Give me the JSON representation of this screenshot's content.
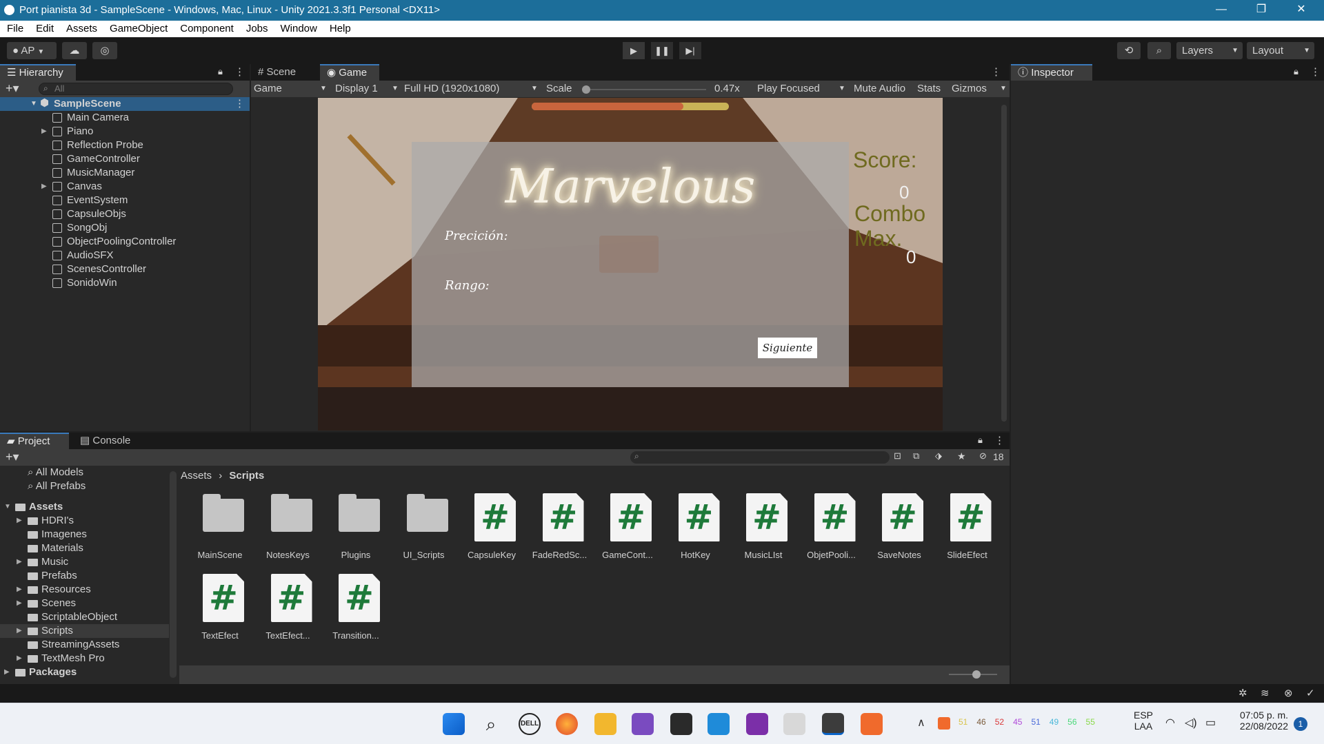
{
  "window": {
    "title": "Port pianista 3d - SampleScene - Windows, Mac, Linux - Unity 2021.3.3f1 Personal <DX11>",
    "controls": [
      "—",
      "❐",
      "✕"
    ]
  },
  "menu": [
    "File",
    "Edit",
    "Assets",
    "GameObject",
    "Component",
    "Jobs",
    "Window",
    "Help"
  ],
  "toolbar": {
    "account": "AP",
    "layers": "Layers",
    "layout": "Layout"
  },
  "hierarchy": {
    "tab": "Hierarchy",
    "search_placeholder": "All",
    "scene": "SampleScene",
    "items": [
      {
        "label": "Main Camera",
        "expandable": false
      },
      {
        "label": "Piano",
        "expandable": true
      },
      {
        "label": "Reflection Probe",
        "expandable": false
      },
      {
        "label": "GameController",
        "expandable": false
      },
      {
        "label": "MusicManager",
        "expandable": false
      },
      {
        "label": "Canvas",
        "expandable": true
      },
      {
        "label": "EventSystem",
        "expandable": false
      },
      {
        "label": "CapsuleObjs",
        "expandable": false
      },
      {
        "label": "SongObj",
        "expandable": false
      },
      {
        "label": "ObjectPoolingController",
        "expandable": false
      },
      {
        "label": "AudioSFX",
        "expandable": false
      },
      {
        "label": "ScenesController",
        "expandable": false
      },
      {
        "label": "SonidoWin",
        "expandable": false
      }
    ]
  },
  "views": {
    "scene_tab": "Scene",
    "game_tab": "Game",
    "game_dropdown": "Game",
    "display": "Display 1",
    "resolution": "Full HD (1920x1080)",
    "scale_label": "Scale",
    "scale_value": "0.47x",
    "play_focused": "Play Focused",
    "mute_audio": "Mute Audio",
    "stats": "Stats",
    "gizmos": "Gizmos"
  },
  "game": {
    "rating": "Marvelous",
    "precision_label": "Preciciόn:",
    "rank_label": "Rango:",
    "next_button": "Siguiente",
    "score_label": "Score:",
    "score_value": "0",
    "combo_label": "Combo",
    "max_label": "Max.",
    "combo_value": "0",
    "progress": 0.77
  },
  "inspector": {
    "tab": "Inspector"
  },
  "project": {
    "tab_project": "Project",
    "tab_console": "Console",
    "hidden_count": "18",
    "favorites": [
      "All Models",
      "All Prefabs"
    ],
    "assets_root": "Assets",
    "folders": [
      {
        "label": "HDRI's",
        "expandable": true
      },
      {
        "label": "Imagenes",
        "expandable": false
      },
      {
        "label": "Materials",
        "expandable": false
      },
      {
        "label": "Music",
        "expandable": true
      },
      {
        "label": "Prefabs",
        "expandable": false
      },
      {
        "label": "Resources",
        "expandable": true
      },
      {
        "label": "Scenes",
        "expandable": true
      },
      {
        "label": "ScriptableObject",
        "expandable": false
      },
      {
        "label": "Scripts",
        "expandable": true,
        "selected": true
      },
      {
        "label": "StreamingAssets",
        "expandable": false
      },
      {
        "label": "TextMesh Pro",
        "expandable": true
      }
    ],
    "packages": "Packages",
    "breadcrumb": [
      "Assets",
      "Scripts"
    ],
    "assets": [
      {
        "name": "MainScene",
        "kind": "folder"
      },
      {
        "name": "NotesKeys",
        "kind": "folder"
      },
      {
        "name": "Plugins",
        "kind": "folder"
      },
      {
        "name": "UI_Scripts",
        "kind": "folder"
      },
      {
        "name": "CapsuleKey",
        "kind": "script"
      },
      {
        "name": "FadeRedSc...",
        "kind": "script"
      },
      {
        "name": "GameCont...",
        "kind": "script"
      },
      {
        "name": "HotKey",
        "kind": "script"
      },
      {
        "name": "MusicLIst",
        "kind": "script"
      },
      {
        "name": "ObjetPooli...",
        "kind": "script"
      },
      {
        "name": "SaveNotes",
        "kind": "script"
      },
      {
        "name": "SlideEfect",
        "kind": "script"
      },
      {
        "name": "TextEfect",
        "kind": "script"
      },
      {
        "name": "TextEfect...",
        "kind": "script"
      },
      {
        "name": "Transition...",
        "kind": "script"
      }
    ]
  },
  "taskbar": {
    "lang1": "ESP",
    "lang2": "LAA",
    "time": "07:05 p. m.",
    "date": "22/08/2022",
    "notification_count": "1",
    "tray_numbers": [
      "51",
      "46",
      "52",
      "45",
      "51",
      "49",
      "56",
      "55"
    ]
  }
}
